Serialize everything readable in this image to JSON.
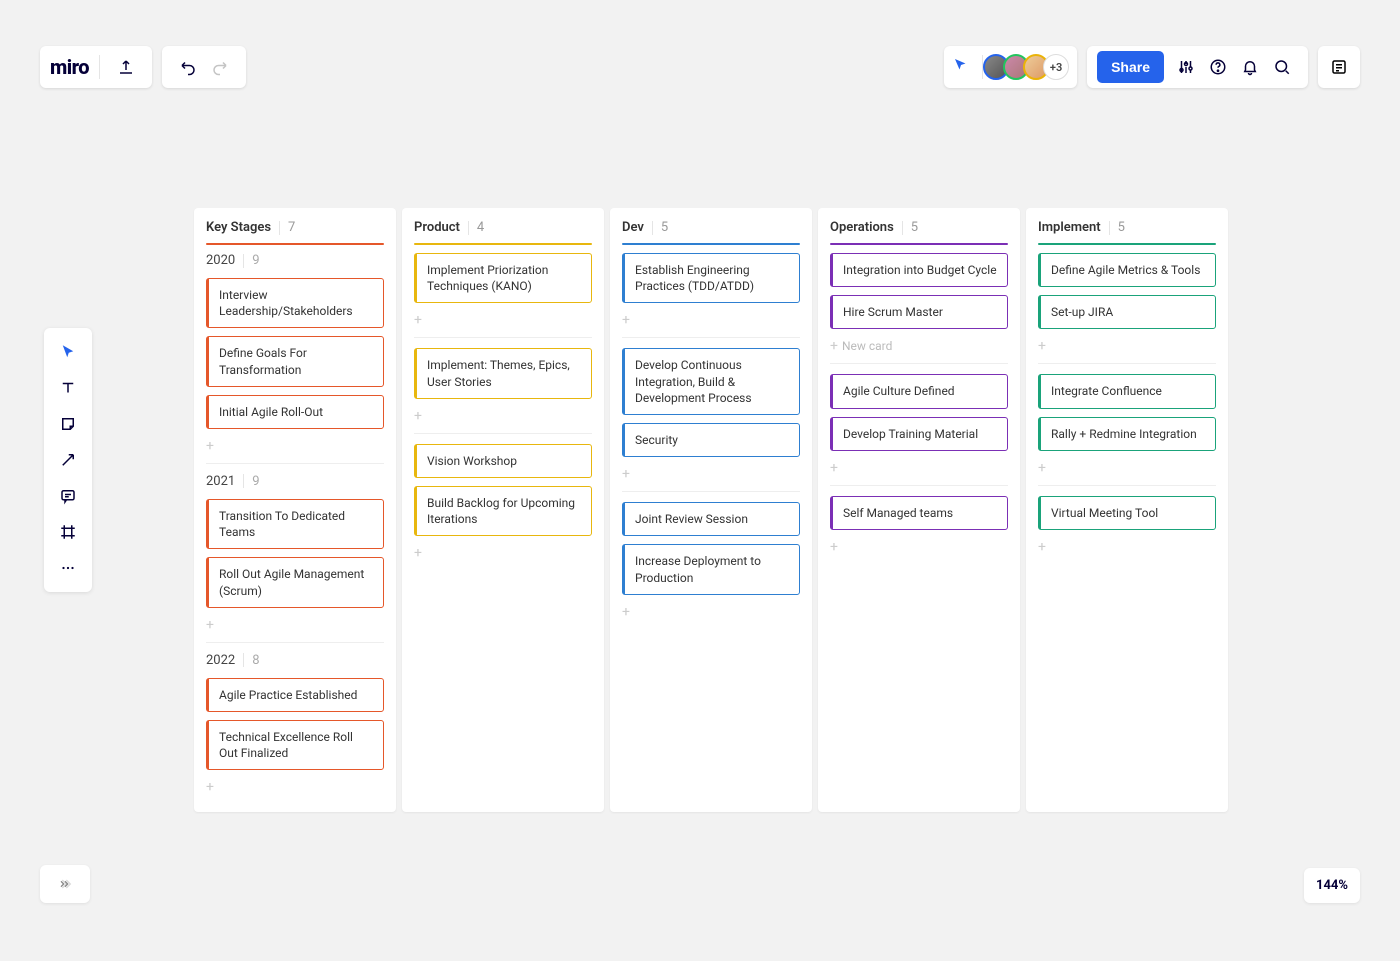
{
  "app": {
    "logo": "miro",
    "undo_redo": {
      "undo": "Undo",
      "redo": "Redo"
    },
    "share_label": "Share",
    "presence_more": "+3",
    "zoom": "144%"
  },
  "board": {
    "swimlanes": [
      {
        "year": "2020",
        "count": "9"
      },
      {
        "year": "2021",
        "count": "9"
      },
      {
        "year": "2022",
        "count": "8"
      }
    ],
    "columns": [
      {
        "title": "Key Stages",
        "count": "7",
        "color": "#e5572a",
        "lanes": [
          [
            "Interview Leadership/Stakeholders",
            "Define Goals For Transformation",
            "Initial Agile Roll-Out"
          ],
          [
            "Transition To Dedicated Teams",
            "Roll Out Agile Management (Scrum)"
          ],
          [
            "Agile Practice Established",
            "Technical Excellence Roll Out Finalized"
          ]
        ],
        "new_card_label": ""
      },
      {
        "title": "Product",
        "count": "4",
        "color": "#e8b70e",
        "lanes": [
          [
            "Implement Priorization Techniques (KANO)"
          ],
          [
            "Implement: Themes, Epics, User Stories"
          ],
          [
            "Vision Workshop",
            "Build Backlog for Upcoming Iterations"
          ]
        ]
      },
      {
        "title": "Dev",
        "count": "5",
        "color": "#2e7fd1",
        "lanes": [
          [
            "Establish Engineering Practices (TDD/ATDD)"
          ],
          [
            "Develop Continuous Integration, Build & Development Process",
            "Security"
          ],
          [
            "Joint Review Session",
            "Increase Deployment to Production"
          ]
        ]
      },
      {
        "title": "Operations",
        "count": "5",
        "color": "#7b2fb5",
        "lanes": [
          [
            "Integration into Budget Cycle",
            "Hire Scrum Master"
          ],
          [
            "Agile Culture Defined",
            "Develop Training Material"
          ],
          [
            "Self Managed teams"
          ]
        ],
        "new_card_label": "New card"
      },
      {
        "title": "Implement",
        "count": "5",
        "color": "#1aa37a",
        "lanes": [
          [
            "Define Agile Metrics & Tools",
            "Set-up JIRA"
          ],
          [
            "Integrate Confluence",
            "Rally + Redmine Integration"
          ],
          [
            "Virtual Meeting Tool"
          ]
        ]
      }
    ]
  }
}
